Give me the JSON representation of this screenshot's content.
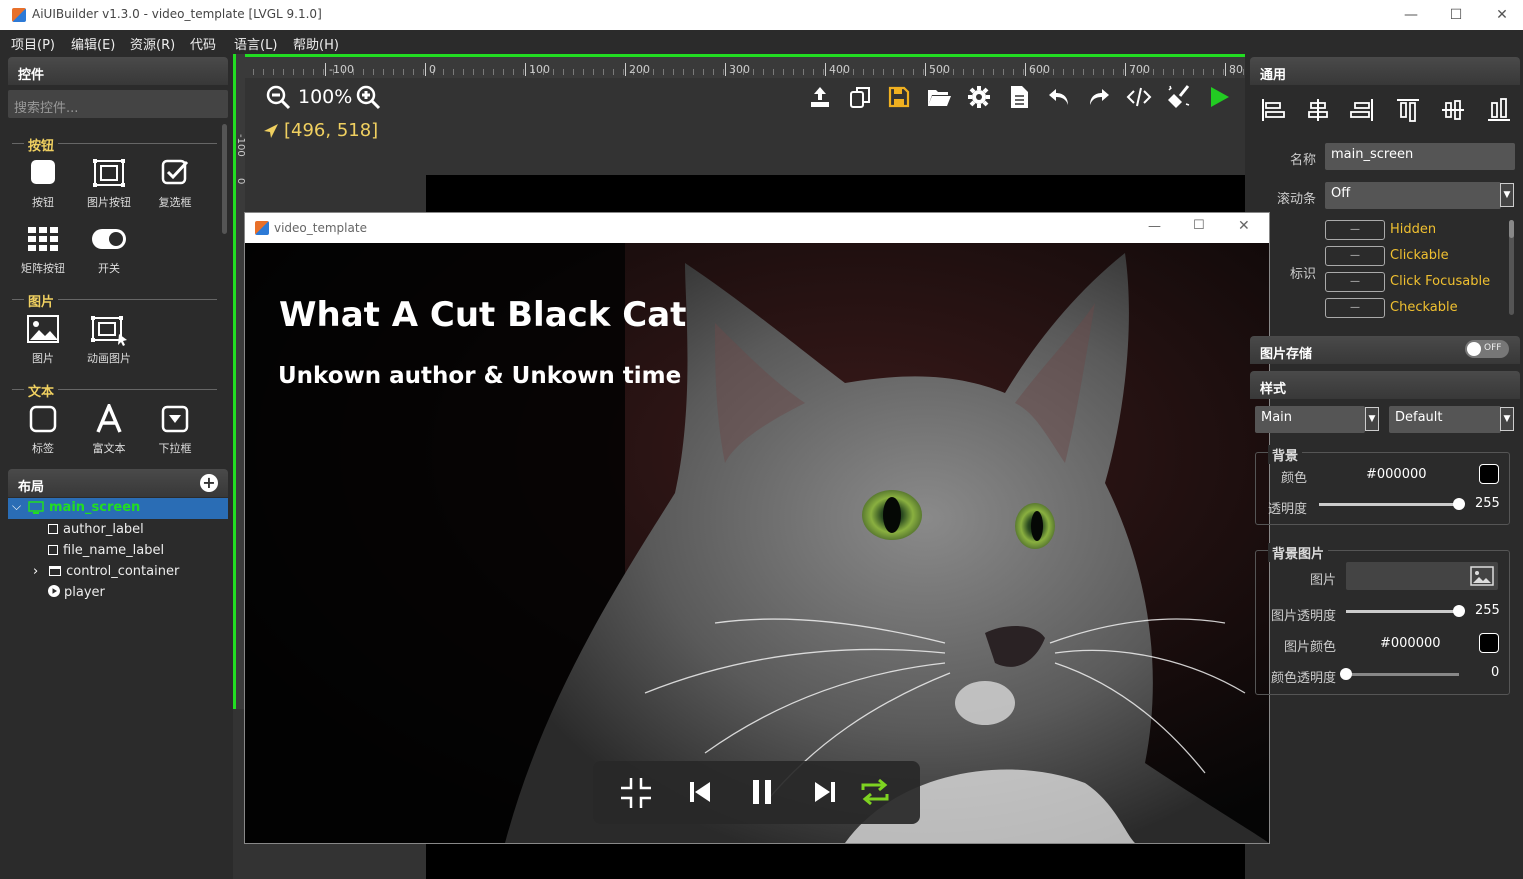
{
  "window": {
    "title": "AiUIBuilder v1.3.0 - video_template [LVGL 9.1.0]",
    "minimize": "—",
    "maximize": "☐",
    "close": "✕"
  },
  "menu": [
    "项目(P)",
    "编辑(E)",
    "资源(R)",
    "代码",
    "语言(L)",
    "帮助(H)"
  ],
  "widgets_panel": {
    "title": "控件",
    "search_placeholder": "搜索控件...",
    "sections": [
      {
        "title": "按钮",
        "items": [
          "按钮",
          "图片按钮",
          "复选框",
          "矩阵按钮",
          "开关"
        ]
      },
      {
        "title": "图片",
        "items": [
          "图片",
          "动画图片"
        ]
      },
      {
        "title": "文本",
        "items": [
          "标签",
          "富文本",
          "下拉框"
        ]
      }
    ]
  },
  "layout_panel": {
    "title": "布局",
    "tree": [
      {
        "name": "main_screen",
        "icon": "monitor-icon",
        "selected": true
      },
      {
        "name": "author_label",
        "icon": "square-icon"
      },
      {
        "name": "file_name_label",
        "icon": "square-icon"
      },
      {
        "name": "control_container",
        "icon": "container-icon",
        "collapsed": true
      },
      {
        "name": "player",
        "icon": "play-circle-icon"
      }
    ]
  },
  "canvas": {
    "zoom": "100%",
    "coords": "[496, 518]",
    "ruler_top": [
      "-100",
      "0",
      "100",
      "200",
      "300",
      "400",
      "500",
      "600",
      "700",
      "80"
    ],
    "ruler_left": [
      "-100",
      "0"
    ]
  },
  "preview_window": {
    "title": "video_template",
    "video_title": "What A Cut Black Cat",
    "video_subtitle": "Unkown author & Unkown time",
    "controls": [
      "exit-fullscreen-icon",
      "skip-previous-icon",
      "pause-icon",
      "skip-next-icon",
      "repeat-icon"
    ],
    "accent": "#7ed321"
  },
  "props": {
    "general_title": "通用",
    "name_label": "名称",
    "name_value": "main_screen",
    "scrollbar_label": "滚动条",
    "scrollbar_value": "Off",
    "flags_label": "标识",
    "flags": [
      "Hidden",
      "Clickable",
      "Click Focusable",
      "Checkable"
    ],
    "flag_box": "—",
    "image_cache_title": "图片存储",
    "image_cache_toggle": "OFF",
    "style_title": "样式",
    "style_part": "Main",
    "style_state": "Default",
    "bg_title": "背景",
    "bg_color_label": "颜色",
    "bg_color_value": "#000000",
    "bg_opa_label": "透明度",
    "bg_opa_value": "255",
    "bg_opa_fraction": 1.0,
    "bgimg_title": "背景图片",
    "bgimg_label": "图片",
    "bgimg_opa_label": "图片透明度",
    "bgimg_opa_value": "255",
    "bgimg_opa_fraction": 1.0,
    "bgimg_color_label": "图片颜色",
    "bgimg_color_value": "#000000",
    "bgimg_recolor_label": "颜色透明度",
    "bgimg_recolor_value": "0",
    "bgimg_recolor_fraction": 0.0
  },
  "colors": {
    "accent_green": "#22dd22",
    "section_yellow": "#f0d060",
    "flag_orange": "#f0c030",
    "selection_blue": "#2a6db5"
  }
}
